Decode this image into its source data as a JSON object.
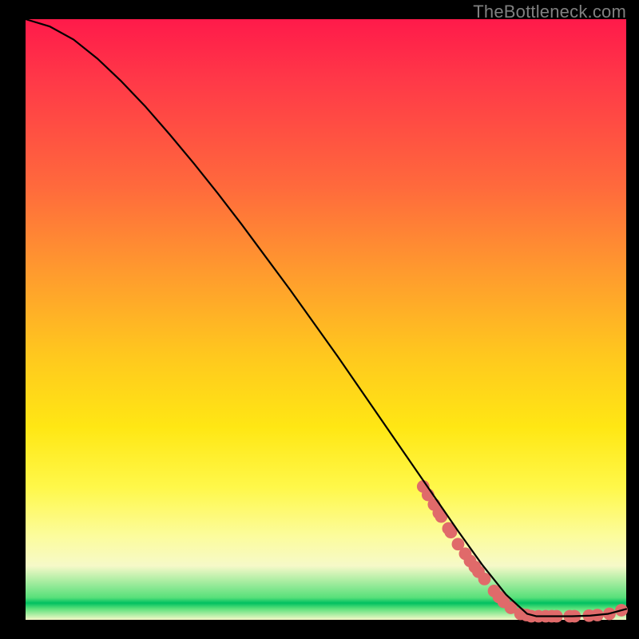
{
  "watermark": "TheBottleneck.com",
  "chart_data": {
    "type": "line",
    "title": "",
    "xlabel": "",
    "ylabel": "",
    "xlim": [
      0,
      100
    ],
    "ylim": [
      0,
      100
    ],
    "curve": {
      "name": "bottleneck-curve",
      "color": "#000000",
      "x": [
        0,
        4,
        8,
        12,
        16,
        20,
        24,
        28,
        32,
        36,
        40,
        44,
        48,
        52,
        56,
        60,
        64,
        68,
        72,
        76,
        80,
        83.5,
        85,
        88,
        91,
        94,
        97,
        100
      ],
      "y": [
        100,
        98.8,
        96.6,
        93.4,
        89.6,
        85.4,
        80.8,
        76.0,
        71.0,
        65.8,
        60.4,
        55.0,
        49.4,
        43.8,
        38.0,
        32.2,
        26.4,
        20.6,
        14.8,
        9.2,
        4.2,
        1.0,
        0.6,
        0.6,
        0.6,
        0.7,
        1.0,
        1.8
      ]
    },
    "points": {
      "name": "data-points",
      "color": "#e06a6a",
      "radius_pct": 1.05,
      "coords": [
        [
          66.2,
          22.2
        ],
        [
          67.0,
          20.8
        ],
        [
          68.0,
          19.2
        ],
        [
          68.8,
          17.8
        ],
        [
          69.2,
          17.2
        ],
        [
          70.4,
          15.2
        ],
        [
          70.8,
          14.6
        ],
        [
          72.0,
          12.6
        ],
        [
          73.2,
          11.0
        ],
        [
          74.0,
          9.8
        ],
        [
          74.8,
          8.8
        ],
        [
          75.4,
          8.0
        ],
        [
          76.4,
          6.8
        ],
        [
          78.0,
          4.8
        ],
        [
          78.8,
          3.8
        ],
        [
          79.6,
          3.0
        ],
        [
          80.8,
          2.0
        ],
        [
          82.4,
          1.0
        ],
        [
          83.4,
          0.8
        ],
        [
          84.2,
          0.6
        ],
        [
          85.4,
          0.6
        ],
        [
          86.6,
          0.6
        ],
        [
          87.6,
          0.6
        ],
        [
          88.4,
          0.6
        ],
        [
          90.6,
          0.6
        ],
        [
          91.4,
          0.6
        ],
        [
          93.8,
          0.7
        ],
        [
          95.2,
          0.8
        ],
        [
          97.2,
          1.0
        ],
        [
          99.2,
          1.6
        ]
      ]
    }
  }
}
